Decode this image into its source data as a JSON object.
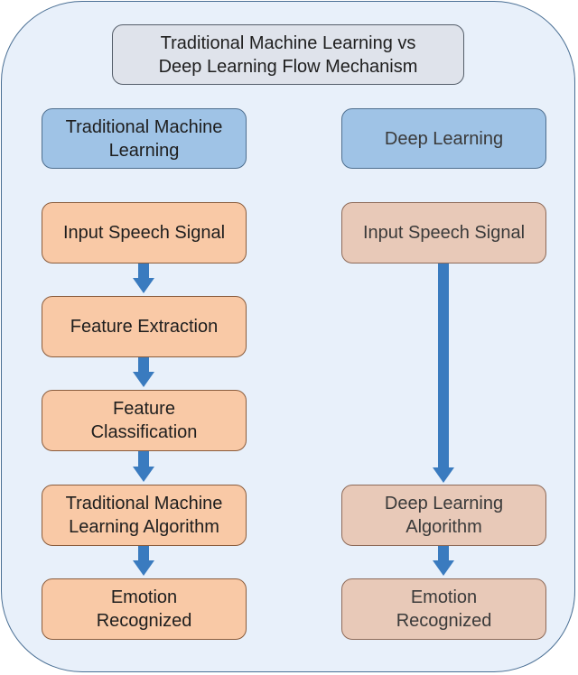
{
  "title": "Traditional Machine Learning vs Deep Learning Flow Mechanism",
  "title_lines": [
    "Traditional Machine Learning vs",
    "Deep Learning Flow Mechanism"
  ],
  "colors": {
    "background": "#e8f0fa",
    "header_fill": "#9fc3e6",
    "traditional_fill": "#f9c9a6",
    "deep_fill": "#e8c9b8",
    "arrow": "#3a7bbf"
  },
  "columns": {
    "traditional": {
      "header": [
        "Traditional Machine",
        "Learning"
      ],
      "steps": [
        {
          "lines": [
            "Input Speech Signal"
          ]
        },
        {
          "lines": [
            "Feature Extraction"
          ]
        },
        {
          "lines": [
            "Feature",
            "Classification"
          ]
        },
        {
          "lines": [
            "Traditional Machine",
            "Learning Algorithm"
          ]
        },
        {
          "lines": [
            "Emotion",
            "Recognized"
          ]
        }
      ]
    },
    "deep": {
      "header": [
        "Deep Learning"
      ],
      "steps": [
        {
          "lines": [
            "Input Speech Signal"
          ]
        },
        {
          "lines": [
            "Deep Learning",
            "Algorithm"
          ]
        },
        {
          "lines": [
            "Emotion",
            "Recognized"
          ]
        }
      ]
    }
  }
}
